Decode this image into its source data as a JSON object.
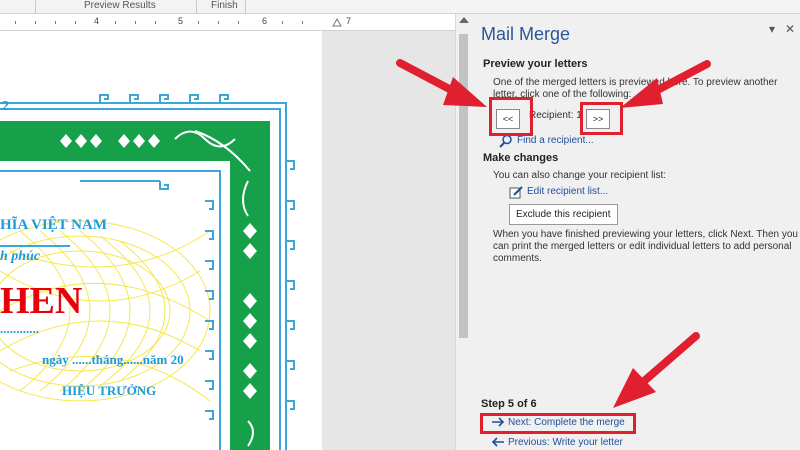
{
  "ribbon": {
    "preview_results": "Preview Results",
    "finish": "Finish"
  },
  "ruler": {
    "marks": [
      "4",
      "5",
      "6",
      "7"
    ]
  },
  "document": {
    "number": "2",
    "line1": "HĨA VIỆT NAM",
    "line2": "h phúc",
    "title": "HEN",
    "dots": "............",
    "date_line": "ngày ......tháng......năm 20",
    "signer": "HIỆU TRƯỞNG"
  },
  "pane": {
    "title": "Mail Merge",
    "dropdown_icon": "▾",
    "close_icon": "✕",
    "preview_heading": "Preview your letters",
    "preview_desc1": "One of the merged letters is previewed here. To preview another",
    "preview_desc2": "letter, click one of the following:",
    "prev_label": "<<",
    "recipient_label": "Recipient: 1",
    "next_label": ">>",
    "find_recipient": "Find a recipient...",
    "changes_heading": "Make changes",
    "changes_desc": "You can also change your recipient list:",
    "edit_list": "Edit recipient list...",
    "exclude_label": "Exclude this recipient",
    "finish_desc1": "When you have finished previewing your letters, click Next. Then you",
    "finish_desc2": "can print the merged letters or edit individual letters to add personal",
    "finish_desc3": "comments.",
    "step_label": "Step 5 of 6",
    "next_step": "Next: Complete the merge",
    "prev_step": "Previous: Write your letter"
  },
  "colors": {
    "accent_red": "#e0202f",
    "border_green": "#16a04a",
    "title_red": "#e8000b",
    "text_blue": "#1e9ad6",
    "link_blue": "#1f4e9c"
  }
}
